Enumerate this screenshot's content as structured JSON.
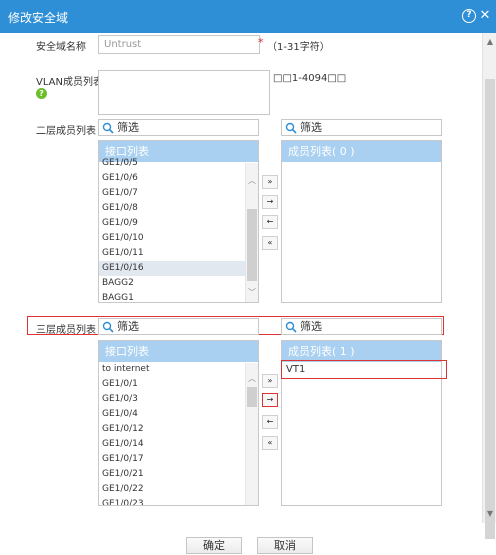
{
  "dialog": {
    "title": "修改安全域"
  },
  "form": {
    "name": {
      "label": "安全域名称",
      "value": "Untrust",
      "required_mark": "*",
      "hint": "（1-31字符）"
    },
    "vlan": {
      "label": "VLAN成员列表",
      "value": "",
      "hint": "□□1-4094□□"
    }
  },
  "layer2": {
    "label": "二层成员列表",
    "filter_left": "筛选",
    "filter_right": "筛选",
    "available": {
      "header": "接口列表",
      "items": [
        "GE1/0/5",
        "GE1/0/6",
        "GE1/0/7",
        "GE1/0/8",
        "GE1/0/9",
        "GE1/0/10",
        "GE1/0/11",
        "GE1/0/16",
        "BAGG2",
        "BAGG1"
      ],
      "selected_item": "GE1/0/16"
    },
    "members": {
      "header": "成员列表( 0 )",
      "items": []
    }
  },
  "layer3": {
    "label": "三层成员列表",
    "filter_left": "筛选",
    "filter_right": "筛选",
    "available": {
      "header": "接口列表",
      "items": [
        "to internet",
        "GE1/0/1",
        "GE1/0/3",
        "GE1/0/4",
        "GE1/0/12",
        "GE1/0/14",
        "GE1/0/17",
        "GE1/0/21",
        "GE1/0/22",
        "GE1/0/23"
      ]
    },
    "members": {
      "header": "成员列表( 1 )",
      "items": [
        "VT1"
      ]
    }
  },
  "move_buttons": {
    "add_all": "»",
    "add": "→",
    "remove": "←",
    "remove_all": "«"
  },
  "footer": {
    "ok": "确定",
    "cancel": "取消"
  },
  "colors": {
    "titlebar": "#2f8fd6",
    "list_header": "#a9d0f0",
    "highlight": "#dd3333"
  }
}
